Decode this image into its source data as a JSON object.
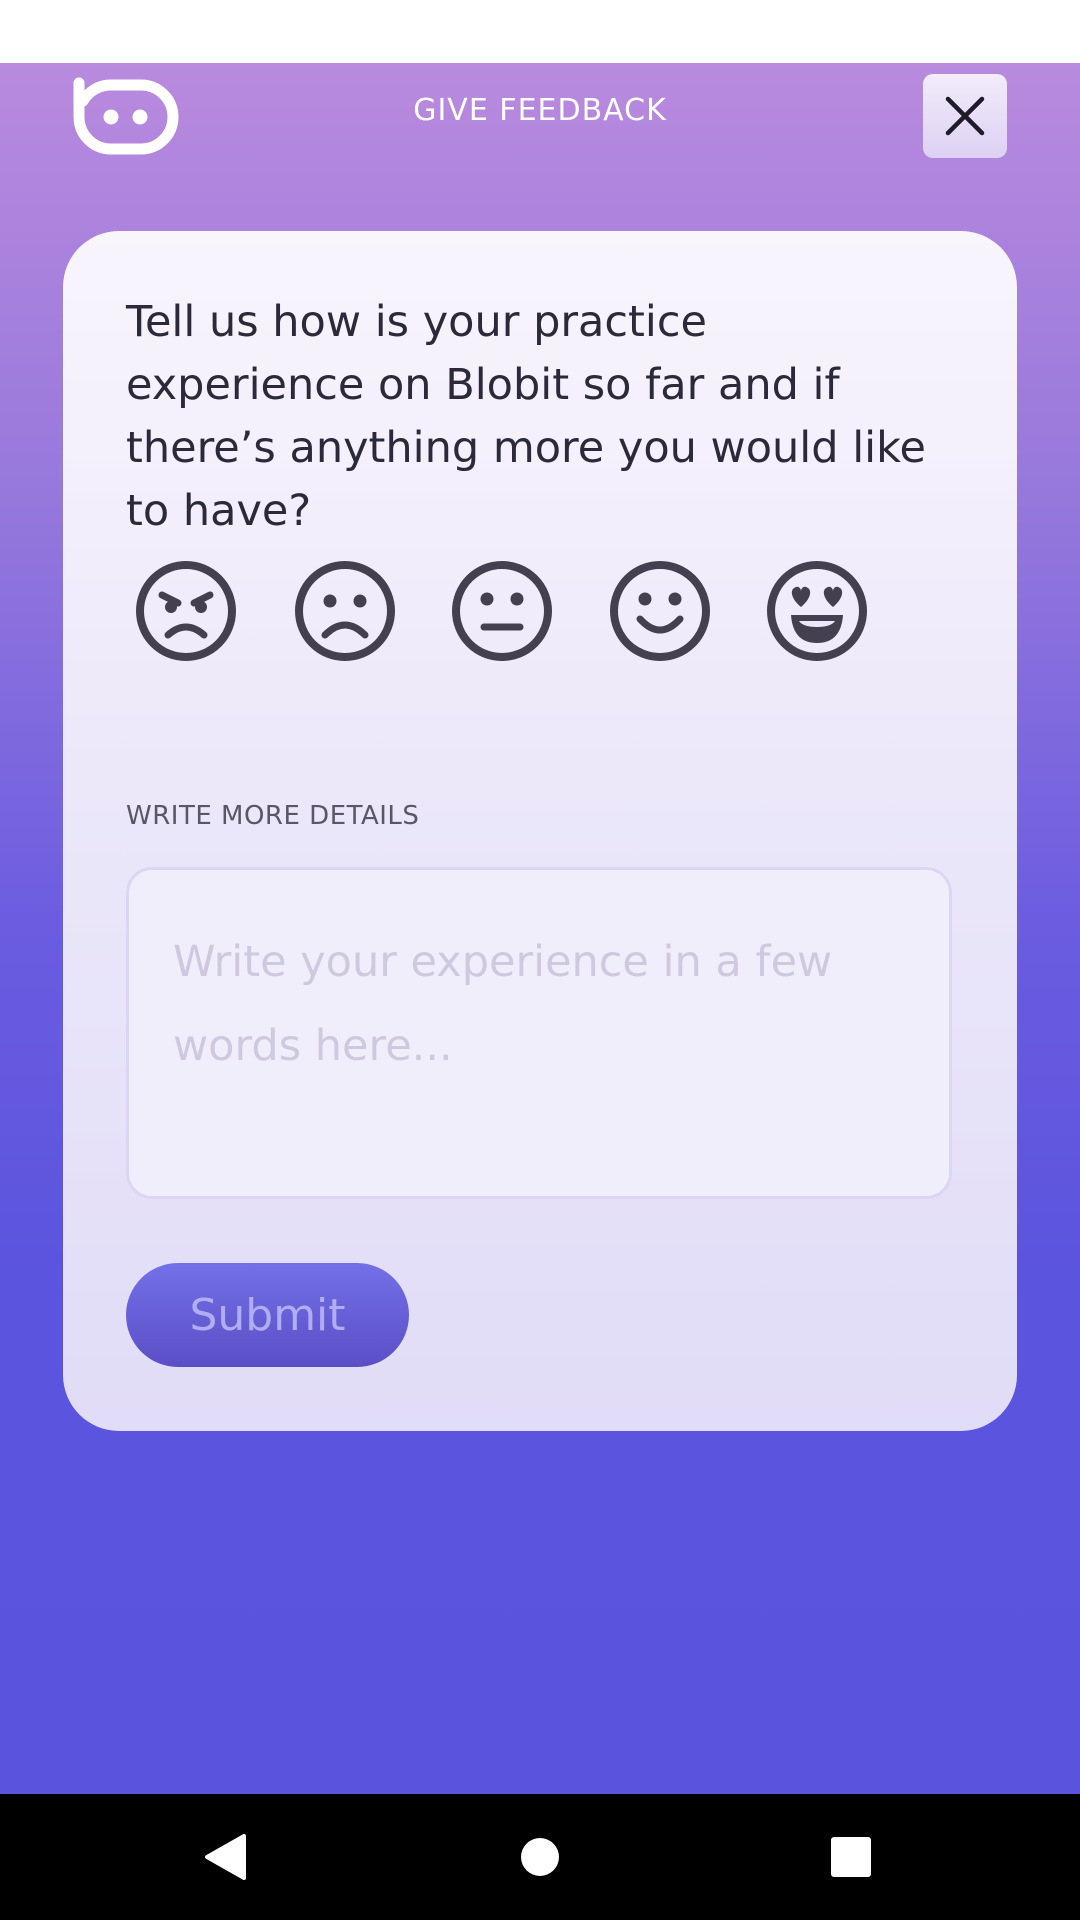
{
  "header": {
    "title": "GIVE FEEDBACK",
    "logo_icon": "blobit-logo-icon",
    "close_icon": "close-icon"
  },
  "card": {
    "question": "Tell us how is your practice experience on Blobit so far and if there’s anything more you would like to have?",
    "ratings": [
      {
        "icon": "angry-face-icon"
      },
      {
        "icon": "sad-face-icon"
      },
      {
        "icon": "neutral-face-icon"
      },
      {
        "icon": "smiling-face-icon"
      },
      {
        "icon": "heart-eyes-face-icon"
      }
    ],
    "details_label": "WRITE MORE DETAILS",
    "details_value": "",
    "details_placeholder": "Write your experience in a few words here...",
    "submit_label": "Submit"
  },
  "navigation": {
    "back_icon": "back-triangle-icon",
    "home_icon": "home-circle-icon",
    "recents_icon": "recents-square-icon"
  },
  "colors": {
    "background_top": "#b98ade",
    "background_bottom": "#5953dd",
    "icon_stroke": "#45404f",
    "submit_button": "#6762dd"
  }
}
